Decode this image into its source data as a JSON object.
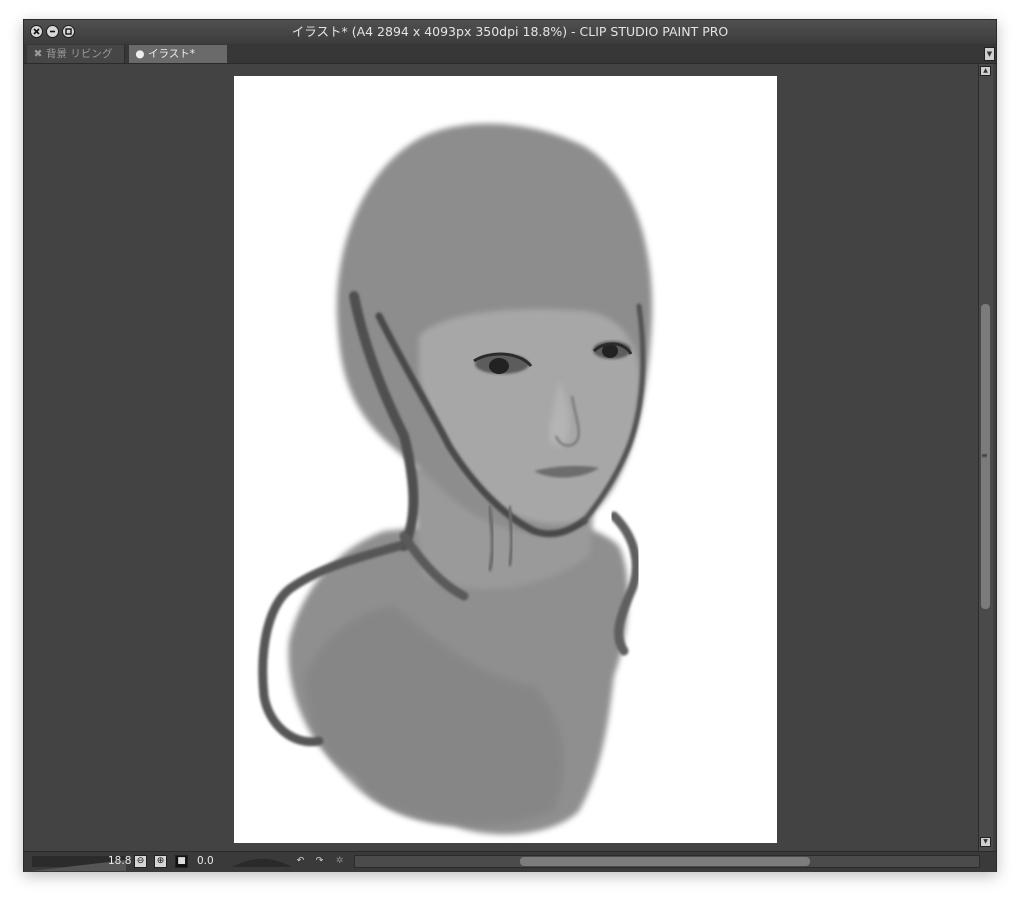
{
  "window": {
    "title": "イラスト* (A4 2894 x 4093px 350dpi 18.8%)  - CLIP STUDIO PAINT PRO",
    "controls": {
      "close_icon": "close-icon",
      "minimize_icon": "minimize-icon",
      "maximize_icon": "maximize-icon"
    }
  },
  "tabs": [
    {
      "label": "背景 リビング",
      "icon": "close-icon",
      "active": false
    },
    {
      "label": "イラスト*",
      "icon": "unsaved-dot-icon",
      "active": true
    }
  ],
  "canvas": {
    "artwork": "grayscale digital painting of a face and shoulders on white paper"
  },
  "statusbar": {
    "zoom_value": "18.8",
    "rotation_value": "0.0",
    "buttons": [
      "zoom-out-icon",
      "zoom-in-icon",
      "fit-icon",
      "rotate-left-icon",
      "rotate-right-icon",
      "reset-rotation-icon"
    ]
  },
  "colors": {
    "workspace": "#434343",
    "titlebar": "#444444",
    "active_tab": "#6a6a6a",
    "paper": "#ffffff"
  }
}
